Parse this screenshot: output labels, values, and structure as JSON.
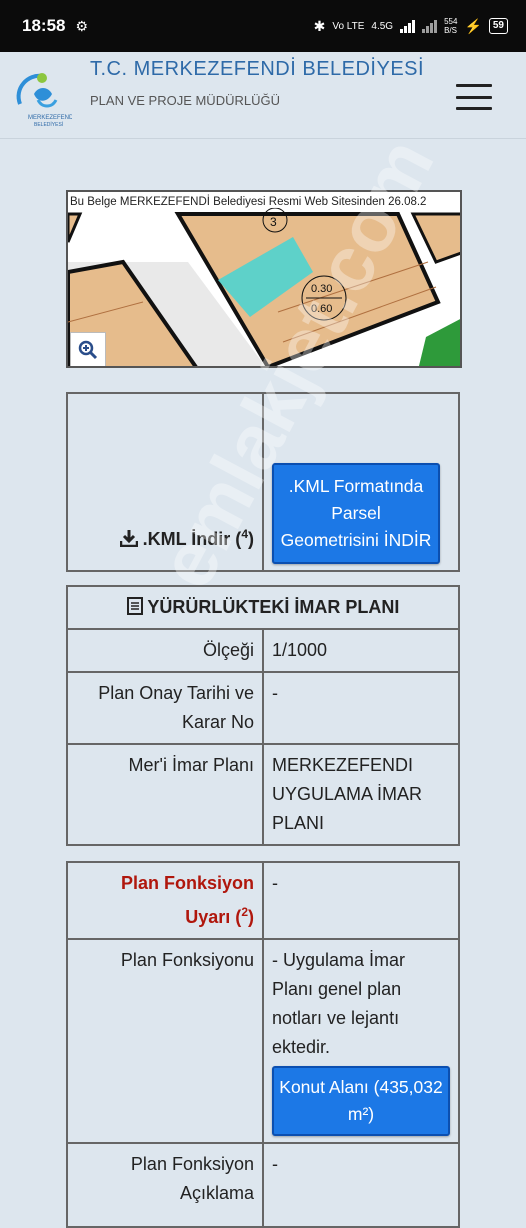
{
  "status_bar": {
    "time": "18:58",
    "network_label": "4.5G",
    "speed_label": "554\nB/S",
    "battery": "59"
  },
  "header": {
    "title": "T.C. MERKEZEFENDİ BELEDİYESİ",
    "subtitle": "PLAN VE PROJE MÜDÜRLÜĞÜ",
    "logo_text": "MERKEZEFENDİ BELEDİYESİ"
  },
  "map": {
    "notice": "Bu Belge MERKEZEFENDİ Belediyesi Resmi Web Sitesinden 26.08.2",
    "parcel_no": "3",
    "ratio_top": "0.30",
    "ratio_bottom": "0.60",
    "zoom_icon": "zoom-in-icon"
  },
  "kml": {
    "download_label": ".KML İndir (",
    "download_sup": "4",
    "download_close": ")",
    "button_label": ".KML Formatında Parsel Geometrisini İNDİR"
  },
  "plan": {
    "heading": "YÜRÜRLÜKTEKİ İMAR PLANI",
    "rows": [
      {
        "label": "Ölçeği",
        "value": "1/1000"
      },
      {
        "label": "Plan Onay Tarihi ve Karar No",
        "value": "-"
      },
      {
        "label": "Mer'i İmar Planı",
        "value": "MERKEZEFENDI UYGULAMA İMAR PLANI"
      }
    ]
  },
  "function": {
    "warning_label": "Plan Fonksiyon Uyarı (",
    "warning_sup": "2",
    "warning_close": ")",
    "warning_value": "-",
    "func_label": "Plan Fonksiyonu",
    "func_value": "- Uygulama İmar Planı genel plan notları ve lejantı ektedir.",
    "func_button": "Konut Alanı (435,032 m²)",
    "desc_label": "Plan Fonksiyon Açıklama",
    "desc_value": "-"
  },
  "colors": {
    "accent": "#1c78e6",
    "title": "#2e6aa8",
    "warning": "#b0170d",
    "parcel_fill": "#e6bc8c",
    "highlight": "#4fd3cf"
  },
  "watermark": "emlakjet.com"
}
